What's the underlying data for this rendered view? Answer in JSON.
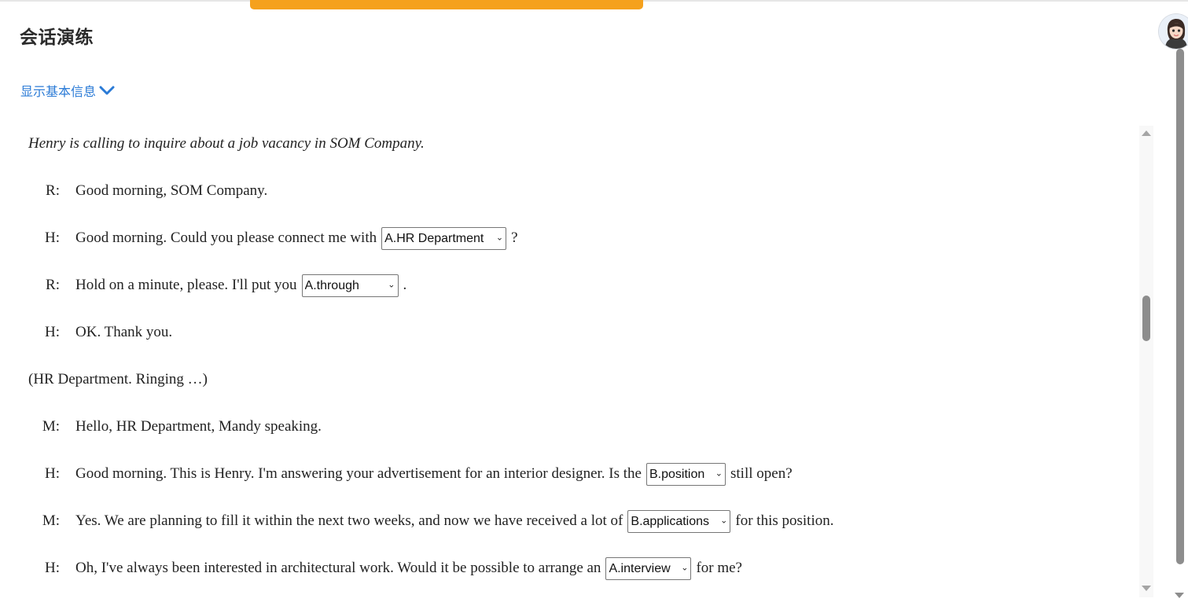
{
  "header": {
    "title": "会话演练",
    "show_info_label": "显示基本信息"
  },
  "dialogue": {
    "intro": "Henry is calling to inquire about a job vacancy in SOM Company.",
    "narration": "(HR Department. Ringing …)",
    "lines": [
      {
        "speaker": "R:",
        "before": "Good morning, SOM Company.",
        "select": null,
        "after": ""
      },
      {
        "speaker": "H:",
        "before": "Good morning. Could you please connect me with",
        "select": "A.HR Department",
        "after": "?"
      },
      {
        "speaker": "R:",
        "before": "Hold on a minute, please. I'll put you",
        "select": "A.through",
        "after": "."
      },
      {
        "speaker": "H:",
        "before": "OK. Thank you.",
        "select": null,
        "after": ""
      },
      {
        "speaker": "M:",
        "before": "Hello, HR Department, Mandy speaking.",
        "select": null,
        "after": ""
      },
      {
        "speaker": "H:",
        "before": "Good morning. This is Henry. I'm answering your advertisement for an interior designer. Is the",
        "select": "B.position",
        "after": "still open?"
      },
      {
        "speaker": "M:",
        "before": "Yes. We are planning to fill it within the next two weeks, and now we have received a lot of",
        "select": "B.applications",
        "after": "for this position."
      },
      {
        "speaker": "H:",
        "before": "Oh, I've always been interested in architectural work. Would it be possible to arrange an",
        "select": "A.interview",
        "after": "for me?"
      }
    ]
  },
  "colors": {
    "accent_orange": "#f5a11d",
    "link_blue": "#2b7bd6"
  },
  "icons": {
    "show_info": "chevron-down-icon",
    "avatar": "user-avatar"
  }
}
